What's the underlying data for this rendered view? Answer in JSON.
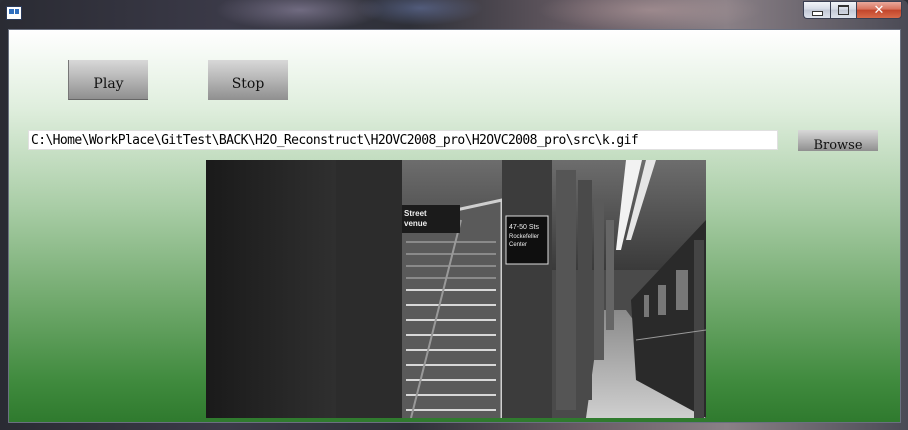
{
  "window": {
    "title": "",
    "buttons": {
      "minimize": "minimize",
      "maximize": "maximize",
      "close": "✕"
    }
  },
  "controls": {
    "play_label": "Play",
    "stop_label": "Stop",
    "browse_label": "Browse",
    "path_value": "C:\\Home\\WorkPlace\\GitTest\\BACK\\H2O_Reconstruct\\H2OVC2008_pro\\H2OVC2008_pro\\src\\k.gif"
  },
  "image": {
    "signs": {
      "street_line1": "Street",
      "street_line2": "venue",
      "station_line1": "47-50 Sts",
      "station_line2": "Rockefeller",
      "station_line3": "Center"
    }
  },
  "colors": {
    "client_top": "#ffffff",
    "client_bottom": "#2f7a2e",
    "button_top": "#d8d8d8",
    "button_bottom": "#8f8f8f"
  }
}
